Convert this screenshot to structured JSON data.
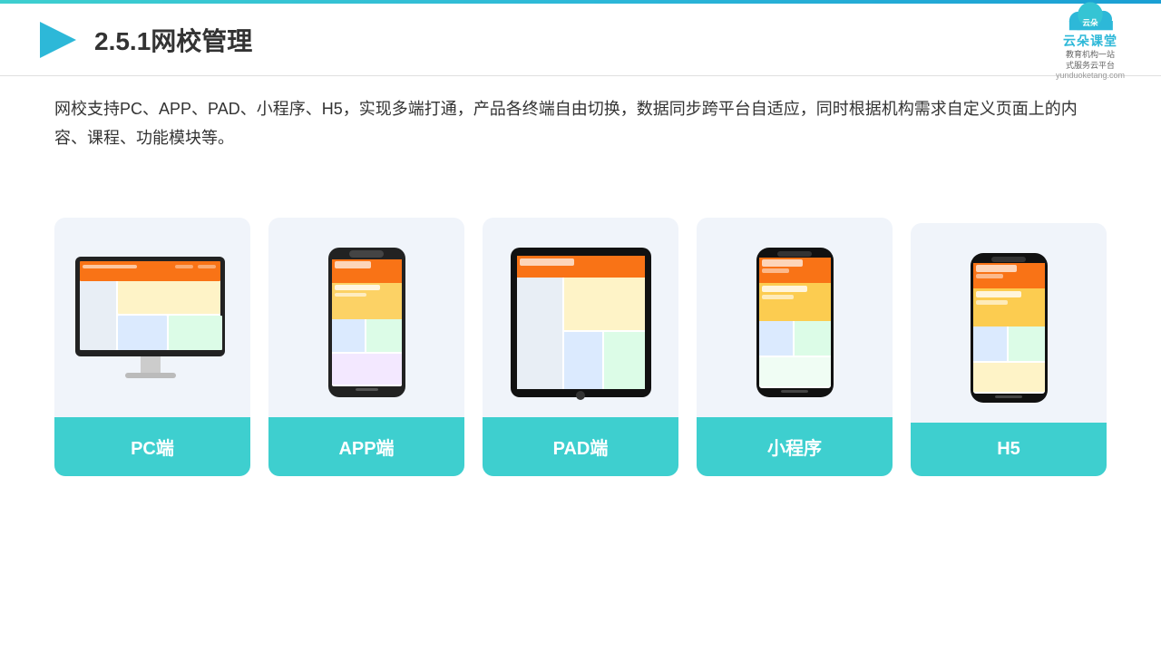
{
  "topLine": {},
  "header": {
    "pageTitle": "2.5.1网校管理",
    "brand": {
      "name": "云朵课堂",
      "sub": "教育机构一站\n式服务云平台",
      "domain": "yunduoketang.com"
    }
  },
  "description": "网校支持PC、APP、PAD、小程序、H5，实现多端打通，产品各终端自由切换，数据同步跨平台自适应，同时根据机构需求自定义页面上的内容、课程、功能模块等。",
  "cards": [
    {
      "id": "pc",
      "label": "PC端"
    },
    {
      "id": "app",
      "label": "APP端"
    },
    {
      "id": "pad",
      "label": "PAD端"
    },
    {
      "id": "miniprogram",
      "label": "小程序"
    },
    {
      "id": "h5",
      "label": "H5"
    }
  ],
  "accentColor": "#3ecfcf"
}
